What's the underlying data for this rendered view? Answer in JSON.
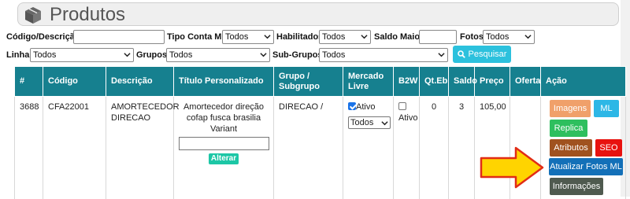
{
  "page": {
    "title": "Produtos",
    "icon": "box-icon"
  },
  "filters": {
    "codigo_label": "Código/Descrição:",
    "codigo_value": "",
    "tipo_conta_label": "Tipo Conta ML:",
    "tipo_conta_value": "Todos",
    "habilitados_label": "Habilitados:",
    "habilitados_value": "Todos",
    "saldo_maior_label": "Saldo Maior:",
    "saldo_maior_value": "",
    "fotos_label": "Fotos:",
    "fotos_value": "Todos",
    "linha_label": "Linha:",
    "linha_value": "Todos",
    "grupos_label": "Grupos:",
    "grupos_value": "Todos",
    "subgrupos_label": "Sub-Grupos:",
    "subgrupos_value": "Todos",
    "search_button": "Pesquisar"
  },
  "table": {
    "headers": [
      "#",
      "Código",
      "Descrição",
      "Título Personalizado",
      "Grupo / Subgrupo",
      "Mercado Livre",
      "B2W",
      "Qt.Eb",
      "Saldo",
      "Preço",
      "Oferta",
      "Ação"
    ],
    "row": {
      "id": "3688",
      "codigo": "CFA22001",
      "descricao": "AMORTECEDOR DIRECAO",
      "titulo": "Amortecedor direção cofap fusca brasilia Variant",
      "titulo_input_value": "",
      "alterar_button": "Alterar",
      "grupo": "DIRECAO /",
      "ml_checkbox_label": "Ativo",
      "ml_checked": true,
      "ml_select_value": "Todos",
      "b2w_checkbox_label": "Ativo",
      "b2w_checked": false,
      "qt_eb": "0",
      "saldo": "3",
      "preco": "105,00",
      "oferta": ""
    }
  },
  "actions": {
    "imagens": "Imagens",
    "ml": "ML",
    "replica": "Replica",
    "atributos": "Atributos",
    "seo": "SEO",
    "atualizar_fotos_ml": "Atualizar Fotos ML",
    "informacoes": "Informações"
  },
  "colors": {
    "table_header": "#16808f",
    "search_button": "#2cc1dd",
    "alterar_button": "#1dc7a6",
    "imagens": "#f0a06a",
    "ml": "#2db7e6",
    "replica": "#2ebf5e",
    "atributos": "#a0521f",
    "seo": "#e8120f",
    "atualizar_fotos_ml": "#1370b8",
    "informacoes": "#4f5a4f",
    "arrow_fill": "#ffd400",
    "arrow_stroke": "#e12c16"
  }
}
